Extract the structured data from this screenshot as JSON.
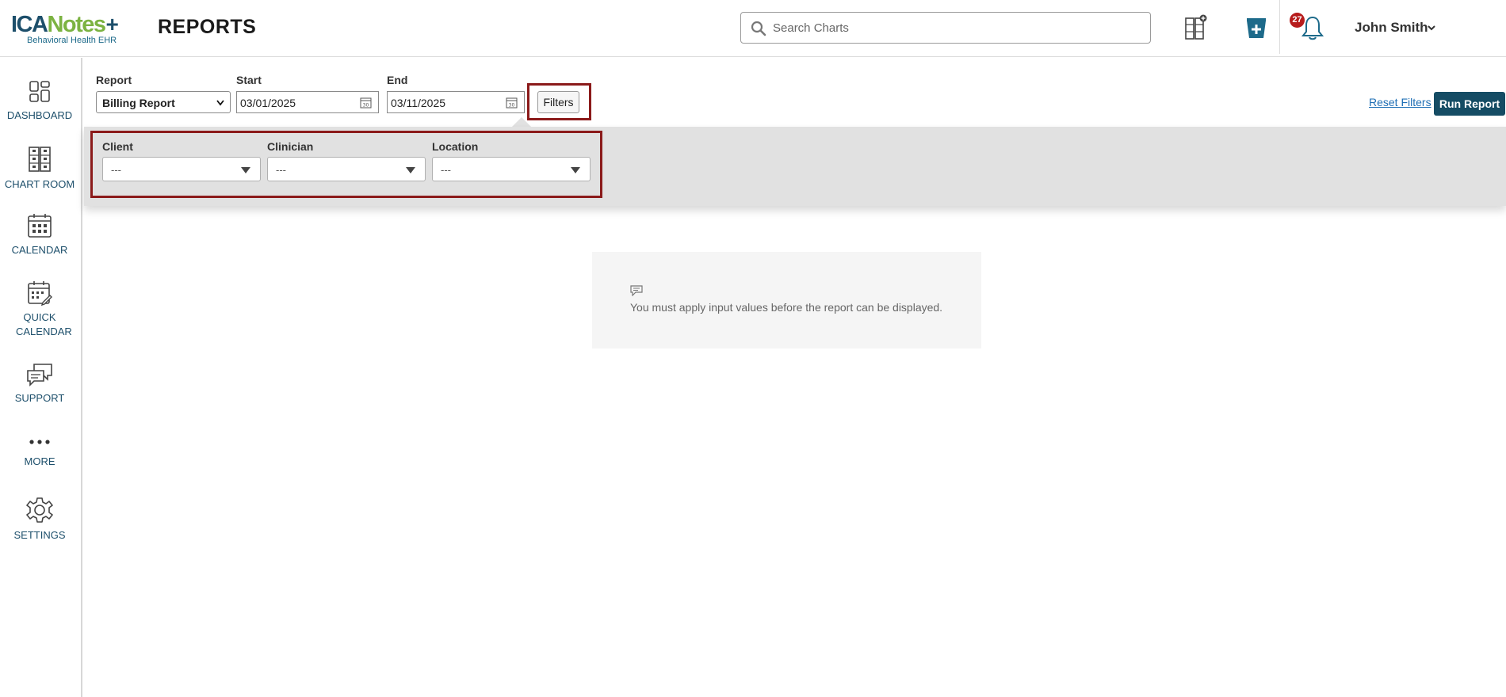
{
  "header": {
    "logo_main_ica": "ICA",
    "logo_main_notes": "Notes",
    "logo_sub": "Behavioral Health EHR",
    "page_title": "REPORTS",
    "search_placeholder": "Search Charts",
    "notification_count": "27",
    "user_name": "John Smith"
  },
  "sidebar": {
    "items": [
      {
        "label": "DASHBOARD",
        "icon": "dashboard-icon"
      },
      {
        "label": "CHART ROOM",
        "icon": "chart-room-icon"
      },
      {
        "label": "CALENDAR",
        "icon": "calendar-icon"
      },
      {
        "label": "QUICK CALENDAR",
        "icon": "quick-calendar-icon"
      },
      {
        "label": "SUPPORT",
        "icon": "support-icon"
      },
      {
        "label": "MORE",
        "icon": "more-icon"
      },
      {
        "label": "SETTINGS",
        "icon": "settings-icon"
      }
    ]
  },
  "toolbar": {
    "report_label": "Report",
    "report_value": "Billing Report",
    "start_label": "Start",
    "start_value": "03/01/2025",
    "end_label": "End",
    "end_value": "03/11/2025",
    "filters_label": "Filters",
    "reset_label": "Reset Filters",
    "run_label": "Run Report"
  },
  "filters": {
    "client_label": "Client",
    "client_value": "---",
    "clinician_label": "Clinician",
    "clinician_value": "---",
    "location_label": "Location",
    "location_value": "---"
  },
  "message": {
    "text": "You must apply input values before the report can be displayed."
  },
  "colors": {
    "brand_blue": "#1d4f6b",
    "brand_green": "#7cb342",
    "run_button": "#154c64",
    "highlight": "#8b1a1a",
    "badge": "#b71c1c",
    "link": "#1f6fb5"
  }
}
